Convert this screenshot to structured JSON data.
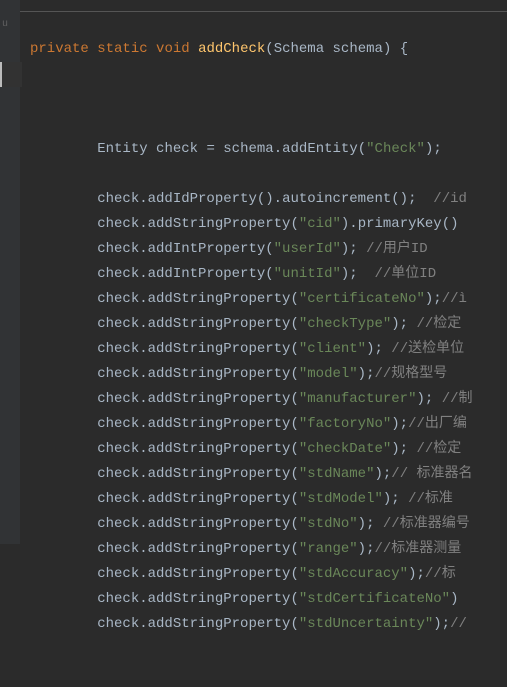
{
  "code": {
    "sig_private": "private",
    "sig_static": "static",
    "sig_void": "void",
    "sig_fn": "addCheck",
    "sig_paramtype": "Schema",
    "sig_paramname": "schema",
    "decl_type": "Entity",
    "decl_name": "check",
    "decl_schema": "schema",
    "decl_addEntity": "addEntity",
    "entity_name": "\"Check\"",
    "lines": [
      {
        "prefix": "        check.",
        "m": "addIdProperty",
        "after": "().",
        "m2": "autoincrement",
        "tail": "();  ",
        "cmt": "//id"
      },
      {
        "prefix": "        check.",
        "m": "addStringProperty",
        "arg": "\"cid\"",
        "after": ").",
        "m2": "primaryKey",
        "tail": "()"
      },
      {
        "prefix": "        check.",
        "m": "addIntProperty",
        "arg": "\"userId\"",
        "tail": "); ",
        "cmt": "//用户ID"
      },
      {
        "prefix": "        check.",
        "m": "addIntProperty",
        "arg": "\"unitId\"",
        "tail": ");  ",
        "cmt": "//单位ID"
      },
      {
        "prefix": "        check.",
        "m": "addStringProperty",
        "arg": "\"certificateNo\"",
        "tail": ");",
        "cmt": "//ì"
      },
      {
        "prefix": "        check.",
        "m": "addStringProperty",
        "arg": "\"checkType\"",
        "tail": "); ",
        "cmt": "//检定"
      },
      {
        "prefix": "        check.",
        "m": "addStringProperty",
        "arg": "\"client\"",
        "tail": "); ",
        "cmt": "//送检单位"
      },
      {
        "prefix": "        check.",
        "m": "addStringProperty",
        "arg": "\"model\"",
        "tail": ");",
        "cmt": "//规格型号"
      },
      {
        "prefix": "        check.",
        "m": "addStringProperty",
        "arg": "\"manufacturer\"",
        "tail": "); ",
        "cmt": "//制"
      },
      {
        "prefix": "        check.",
        "m": "addStringProperty",
        "arg": "\"factoryNo\"",
        "tail": ");",
        "cmt": "//出厂编"
      },
      {
        "prefix": "        check.",
        "m": "addStringProperty",
        "arg": "\"checkDate\"",
        "tail": "); ",
        "cmt": "//检定"
      },
      {
        "prefix": "        check.",
        "m": "addStringProperty",
        "arg": "\"stdName\"",
        "tail": ");",
        "cmt": "// 标准器名"
      },
      {
        "prefix": "        check.",
        "m": "addStringProperty",
        "arg": "\"stdModel\"",
        "tail": "); ",
        "cmt": "//标准"
      },
      {
        "prefix": "        check.",
        "m": "addStringProperty",
        "arg": "\"stdNo\"",
        "tail": "); ",
        "cmt": "//标准器编号"
      },
      {
        "prefix": "        check.",
        "m": "addStringProperty",
        "arg": "\"range\"",
        "tail": ");",
        "cmt": "//标准器测量"
      },
      {
        "prefix": "        check.",
        "m": "addStringProperty",
        "arg": "\"stdAccuracy\"",
        "tail": ");",
        "cmt": "//标"
      },
      {
        "prefix": "        check.",
        "m": "addStringProperty",
        "arg": "\"stdCertificateNo\"",
        "tail": ")"
      },
      {
        "prefix": "        check.",
        "m": "addStringProperty",
        "arg": "\"stdUncertainty\"",
        "tail": ");",
        "cmt": "//"
      }
    ]
  },
  "gutter": {
    "fold": "u"
  }
}
